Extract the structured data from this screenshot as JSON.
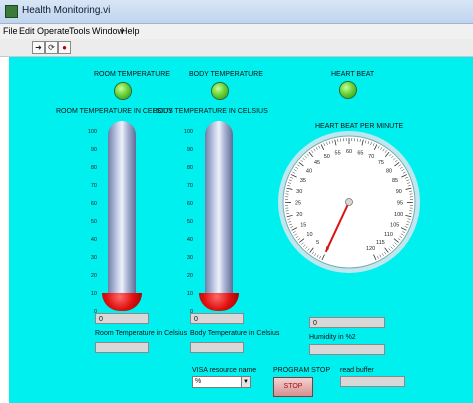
{
  "window": {
    "title": "Health Monitoring.vi"
  },
  "menu": [
    "File",
    "Edit",
    "Operate",
    "Tools",
    "Window",
    "Help"
  ],
  "toolbar": {
    "icons": [
      "run-arrow-icon",
      "run-continuously-icon",
      "abort-icon"
    ]
  },
  "room": {
    "led_label": "ROOM TEMPERATURE",
    "thermo_label": "ROOM TEMPERATURE IN CELSIUS",
    "value": "0",
    "caption": "Room Temperature in Celsius",
    "scale": [
      "100",
      "90",
      "80",
      "70",
      "60",
      "50",
      "40",
      "30",
      "20",
      "10",
      "0"
    ]
  },
  "body": {
    "led_label": "BODY TEMPERATURE",
    "thermo_label": "BODY TEMPERATURE IN CELSIUS",
    "value": "0",
    "caption": "Body Temperature in Celsius",
    "scale": [
      "100",
      "90",
      "80",
      "70",
      "60",
      "50",
      "40",
      "30",
      "20",
      "10",
      "0"
    ]
  },
  "heart": {
    "led_label": "HEART BEAT",
    "gauge_label": "HEART BEAT PER MINUTE",
    "value": "0",
    "gauge_value": 0,
    "ticks": [
      "0",
      "5",
      "10",
      "15",
      "20",
      "25",
      "30",
      "35",
      "40",
      "45",
      "50",
      "55",
      "60",
      "65",
      "70",
      "75",
      "80",
      "85",
      "90",
      "95",
      "100",
      "105",
      "110",
      "115",
      "120"
    ]
  },
  "humidity": {
    "caption": "Humidity in %2"
  },
  "visa": {
    "label": "VISA resource name",
    "value": "%"
  },
  "program_stop": {
    "label": "PROGRAM STOP",
    "button": "STOP"
  },
  "read_buffer": {
    "label": "read buffer"
  },
  "colors": {
    "panel": "#00f0f0",
    "led": "#6ad43a",
    "needle": "#e01010"
  }
}
